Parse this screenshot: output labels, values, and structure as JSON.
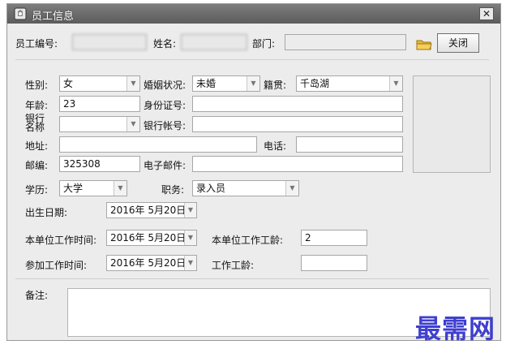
{
  "window": {
    "title": "员工信息",
    "close_glyph": "✕"
  },
  "header": {
    "id_label": "员工编号:",
    "name_label": "姓名:",
    "dept_label": "部门:",
    "close_button": "关闭"
  },
  "form": {
    "gender_label": "性别:",
    "gender_value": "女",
    "marital_label": "婚姻状况:",
    "marital_value": "未婚",
    "hometown_label": "籍贯:",
    "hometown_value": "千岛湖",
    "age_label": "年龄:",
    "age_value": "23",
    "idcard_label": "身份证号:",
    "bank_name_label": "银行名称",
    "bank_account_label": "银行帐号:",
    "address_label": "地址:",
    "phone_label": "电话:",
    "postcode_label": "邮编:",
    "postcode_value": "325308",
    "email_label": "电子邮件:",
    "education_label": "学历:",
    "education_value": "大学",
    "position_label": "职务:",
    "position_value": "录入员",
    "birth_label": "出生日期:",
    "birth_value": "2016年 5月20日",
    "unit_start_label": "本单位工作时间:",
    "unit_start_value": "2016年 5月20日",
    "unit_years_label": "本单位工作工龄:",
    "unit_years_value": "2",
    "work_start_label": "参加工作时间:",
    "work_start_value": "2016年 5月20日",
    "work_years_label": "工作工龄:",
    "notes_label": "备注:"
  },
  "icons": {
    "app": "app-icon",
    "folder": "folder-icon"
  },
  "watermark": "最需网"
}
